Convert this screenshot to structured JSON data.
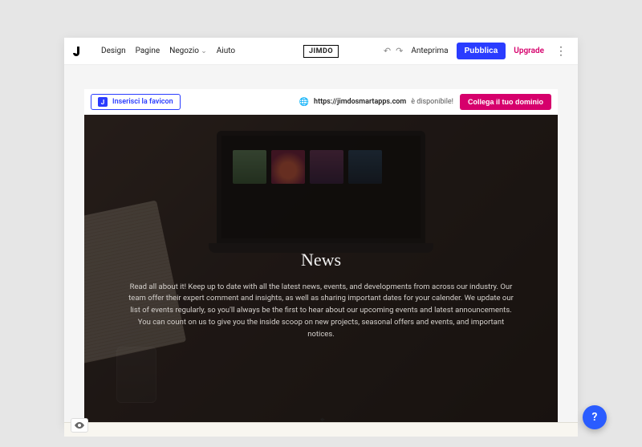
{
  "toolbar": {
    "menu": {
      "design": "Design",
      "pages": "Pagine",
      "shop": "Negozio",
      "help": "Aiuto"
    },
    "brand": "JIMDO",
    "preview": "Anteprima",
    "publish": "Pubblica",
    "upgrade": "Upgrade"
  },
  "page": {
    "favicon_cta": "Inserisci la favicon",
    "domain": {
      "url": "https://jimdosmartapps.com",
      "available_suffix": "è disponibile!"
    },
    "connect_domain": "Collega il tuo dominio"
  },
  "hero": {
    "title": "News",
    "body": "Read all about it! Keep up to date with all the latest news, events, and developments from across our industry. Our team offer their expert comment and insights, as well as sharing important dates for your calender. We update our list of events regularly, so you'll always be the first to hear about our upcoming events and latest announcements. You can count on us to give you the inside scoop on new projects, seasonal offers and events, and important notices."
  },
  "help_fab": "?",
  "colors": {
    "primary": "#2a3cff",
    "accent": "#d6006c"
  }
}
